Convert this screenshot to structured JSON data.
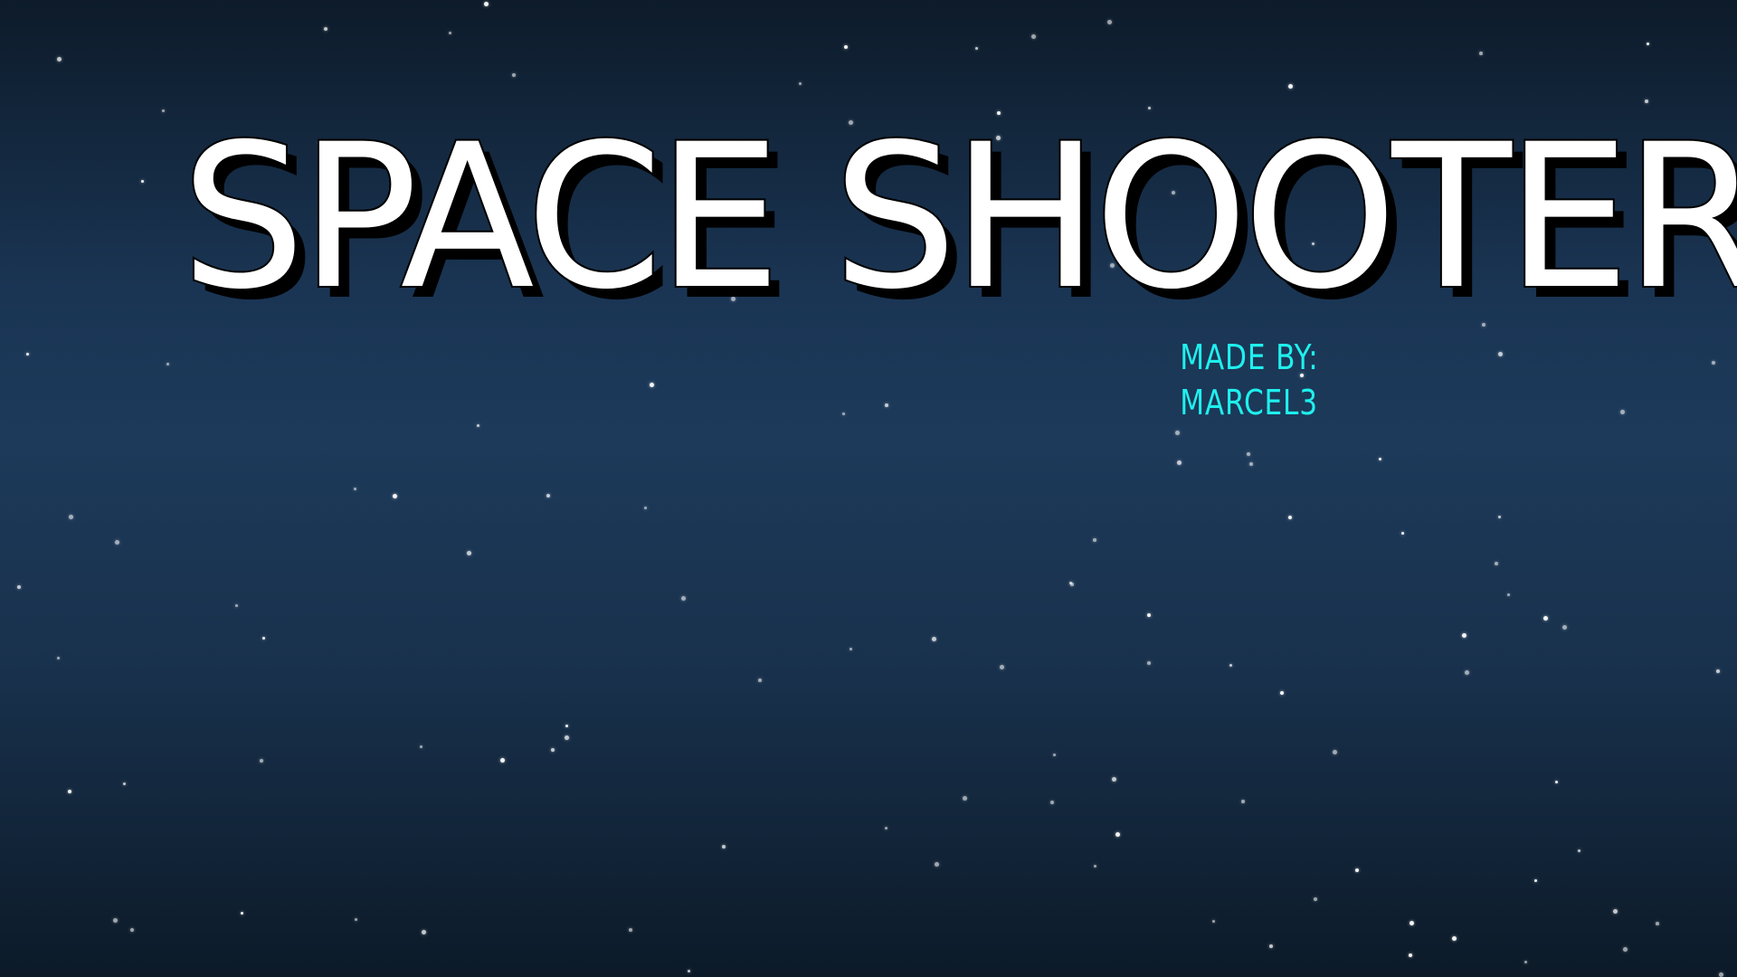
{
  "screen": {
    "title": "SPACE SHOOTER",
    "credit_label": "MADE BY:",
    "credit_name": "MARCEL3"
  },
  "colors": {
    "background_top": "#0d1b2a",
    "background_mid": "#1d3a5a",
    "background_bottom": "#0c1a28",
    "title_fill": "#ffffff",
    "title_shadow": "#000000",
    "credit_text": "#1ff0ee",
    "stars": "#ffffff"
  }
}
